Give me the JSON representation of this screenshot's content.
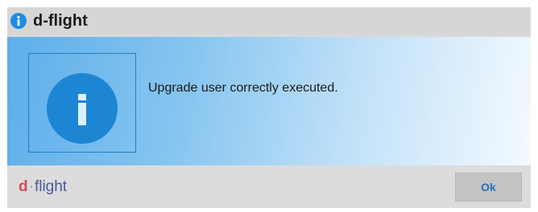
{
  "window": {
    "title": "d-flight",
    "title_icon": "info-icon"
  },
  "content": {
    "icon": "info-icon",
    "message": "Upgrade user correctly executed."
  },
  "footer": {
    "logo_text": "d-flight",
    "logo_d": "d",
    "logo_dot": "·",
    "logo_rest": "flight",
    "ok_label": "Ok"
  },
  "colors": {
    "accent": "#1d86d4",
    "button_text": "#2a6fb8"
  }
}
